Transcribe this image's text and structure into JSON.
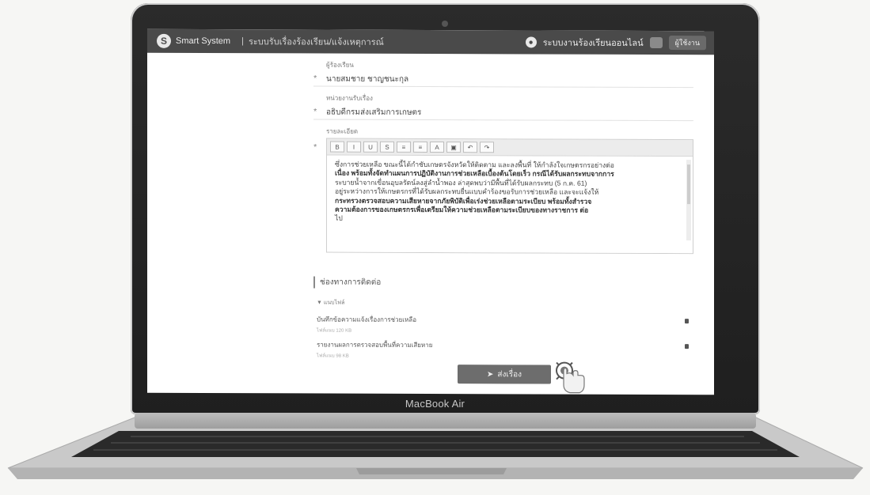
{
  "device": {
    "brand_label": "MacBook Air"
  },
  "appbar": {
    "logo_glyph": "S",
    "app_name": "Smart System",
    "separator": "|",
    "breadcrumb": "ระบบรับเรื่องร้องเรียน/แจ้งเหตุการณ์",
    "user_status": "ระบบงานร้องเรียนออนไลน์",
    "user_button": "ผู้ใช้งาน"
  },
  "form": {
    "fields": [
      {
        "label": "ผู้ร้องเรียน",
        "value": "นายสมชาย ชาญชนะกุล"
      },
      {
        "label": "หน่วยงานรับเรื่อง",
        "value": "อธิบดีกรมส่งเสริมการเกษตร"
      }
    ],
    "detail_label": "รายละเอียด",
    "toolbar_buttons": [
      "B",
      "I",
      "U",
      "S",
      "≡",
      "≡",
      "A",
      "▣",
      "↶",
      "↷"
    ],
    "detail_text": [
      "ซึ่งการช่วยเหลือ ขณะนี้ได้กำชับเกษตรจังหวัดให้ติดตาม และลงพื้นที่ ให้กำลังใจเกษตรกรอย่างต่อ",
      "เนื่อง พร้อมทั้งจัดทำแผนการปฏิบัติงานการช่วยเหลือเบื้องต้นโดยเร็ว กรณีได้รับผลกระทบจากการ",
      "ระบายน้ำจากเขื่อนอุบลรัตน์ลงสู่ลำน้ำพอง ล่าสุดพบว่ามีพื้นที่ได้รับผลกระทบ (5 ก.ค. 61)",
      "อยู่ระหว่างการให้เกษตรกรที่ได้รับผลกระทบยื่นแบบคำร้องขอรับการช่วยเหลือ และจะแจ้งให้",
      "กระทรวงตรวจสอบความเสียหายจากภัยพิบัติเพื่อเร่งช่วยเหลือตามระเบียบ พร้อมทั้งสำรวจ",
      "ความต้องการของเกษตรกรเพื่อเตรียมให้ความช่วยเหลือตามระเบียบของทางราชการ ต่อ",
      "ไป"
    ]
  },
  "attachments": {
    "section_title": "ช่องทางการติดต่อ",
    "group_label": "▼ แนบไฟล์",
    "items": [
      {
        "name": "บันทึกข้อความแจ้งเรื่องการช่วยเหลือ",
        "meta": "ไฟล์แนบ 120 KB"
      },
      {
        "name": "รายงานผลการตรวจสอบพื้นที่ความเสียหาย",
        "meta": "ไฟล์แนบ 98 KB"
      }
    ]
  },
  "submit": {
    "label": "ส่งเรื่อง",
    "icon": "send-icon"
  },
  "colors": {
    "appbar": "#4a4a4a",
    "button": "#6d6d6d"
  }
}
